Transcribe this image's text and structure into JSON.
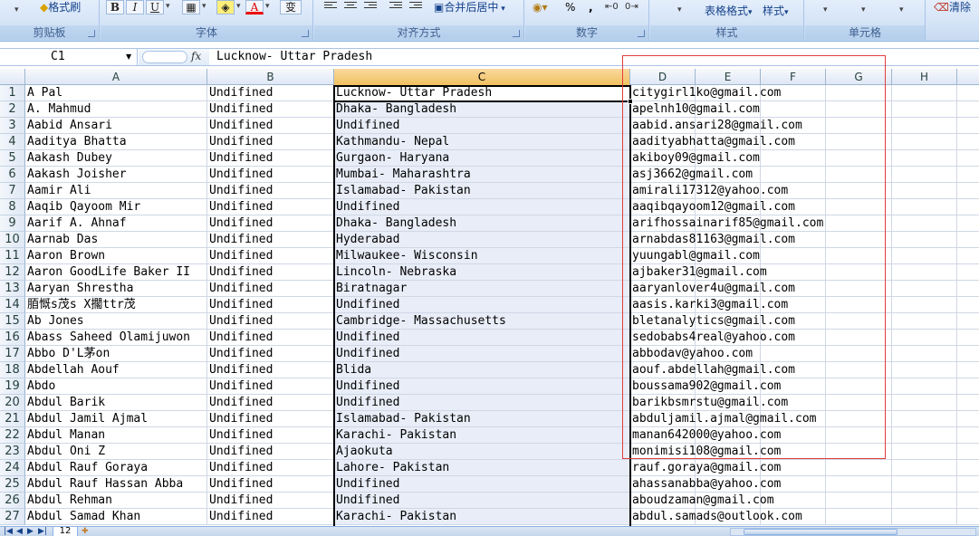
{
  "ribbon": {
    "format_painter_label": "格式刷",
    "clipboard_label": "剪贴板",
    "font_label": "字体",
    "bold_label": "B",
    "italic_label": "I",
    "underline_label": "U",
    "font_color_label": "A",
    "phonetic_label": "变",
    "alignment_label": "对齐方式",
    "merge_center_label": "合并后居中",
    "number_label": "数字",
    "percent_label": "%",
    "comma_label": ",",
    "styles_label": "样式",
    "table_format_label": "表格格式",
    "cell_styles_label": "样式",
    "cells_label": "单元格",
    "clear_label": "清除"
  },
  "formula_bar": {
    "name_box": "C1",
    "fx_label": "fx",
    "content": "Lucknow- Uttar Pradesh"
  },
  "columns": [
    "A",
    "B",
    "C",
    "D",
    "E",
    "F",
    "G",
    "H"
  ],
  "rows": [
    {
      "n": "1",
      "a": "A Pal",
      "b": "Undifined",
      "c": "Lucknow- Uttar Pradesh",
      "d": "citygirl1ko@gmail.com"
    },
    {
      "n": "2",
      "a": "A. Mahmud",
      "b": "Undifined",
      "c": "Dhaka- Bangladesh",
      "d": "apelnh10@gmail.com"
    },
    {
      "n": "3",
      "a": "Aabid Ansari",
      "b": "Undifined",
      "c": "Undifined",
      "d": "aabid.ansari28@gmail.com"
    },
    {
      "n": "4",
      "a": "Aaditya Bhatta",
      "b": "Undifined",
      "c": "Kathmandu- Nepal",
      "d": "aadityabhatta@gmail.com"
    },
    {
      "n": "5",
      "a": "Aakash Dubey",
      "b": "Undifined",
      "c": "Gurgaon- Haryana",
      "d": "akiboy09@gmail.com"
    },
    {
      "n": "6",
      "a": "Aakash Joisher",
      "b": "Undifined",
      "c": "Mumbai- Maharashtra",
      "d": "asj3662@gmail.com"
    },
    {
      "n": "7",
      "a": "Aamir Ali",
      "b": "Undifined",
      "c": "Islamabad- Pakistan",
      "d": "amirali17312@yahoo.com"
    },
    {
      "n": "8",
      "a": "Aaqib Qayoom Mir",
      "b": "Undifined",
      "c": "Undifined",
      "d": "aaqibqayoom12@gmail.com"
    },
    {
      "n": "9",
      "a": "Aarif A. Ahnaf",
      "b": "Undifined",
      "c": "Dhaka- Bangladesh",
      "d": "arifhossainarif85@gmail.com"
    },
    {
      "n": "10",
      "a": "Aarnab Das",
      "b": "Undifined",
      "c": "Hyderabad",
      "d": "arnabdas81163@gmail.com"
    },
    {
      "n": "11",
      "a": "Aaron Brown",
      "b": "Undifined",
      "c": "Milwaukee- Wisconsin",
      "d": "yuungabl@gmail.com"
    },
    {
      "n": "12",
      "a": "Aaron GoodLife Baker II",
      "b": "Undifined",
      "c": "Lincoln- Nebraska",
      "d": "ajbaker31@gmail.com"
    },
    {
      "n": "13",
      "a": "Aaryan Shrestha",
      "b": "Undifined",
      "c": "Biratnagar",
      "d": "aaryanlover4u@gmail.com"
    },
    {
      "n": "14",
      "a": "脜慨s茂s X擱ttr茂",
      "b": "Undifined",
      "c": "Undifined",
      "d": "aasis.karki3@gmail.com"
    },
    {
      "n": "15",
      "a": "Ab Jones",
      "b": "Undifined",
      "c": "Cambridge- Massachusetts",
      "d": "bletanalytics@gmail.com"
    },
    {
      "n": "16",
      "a": "Abass Saheed Olamijuwon",
      "b": "Undifined",
      "c": "Undifined",
      "d": "sedobabs4real@yahoo.com"
    },
    {
      "n": "17",
      "a": "Abbo D'L茅on",
      "b": "Undifined",
      "c": "Undifined",
      "d": "abbodav@yahoo.com"
    },
    {
      "n": "18",
      "a": "Abdellah Aouf",
      "b": "Undifined",
      "c": "Blida",
      "d": "aouf.abdellah@gmail.com"
    },
    {
      "n": "19",
      "a": "Abdo",
      "b": "Undifined",
      "c": "Undifined",
      "d": "boussama902@gmail.com"
    },
    {
      "n": "20",
      "a": "Abdul Barik",
      "b": "Undifined",
      "c": "Undifined",
      "d": "barikbsmrstu@gmail.com"
    },
    {
      "n": "21",
      "a": "Abdul Jamil Ajmal",
      "b": "Undifined",
      "c": "Islamabad- Pakistan",
      "d": "abduljamil.ajmal@gmail.com"
    },
    {
      "n": "22",
      "a": "Abdul Manan",
      "b": "Undifined",
      "c": "Karachi- Pakistan",
      "d": "manan642000@yahoo.com"
    },
    {
      "n": "23",
      "a": "Abdul Oni Z",
      "b": "Undifined",
      "c": "Ajaokuta",
      "d": "monimisi108@gmail.com"
    },
    {
      "n": "24",
      "a": "Abdul Rauf Goraya",
      "b": "Undifined",
      "c": "Lahore- Pakistan",
      "d": "rauf.goraya@gmail.com"
    },
    {
      "n": "25",
      "a": "Abdul Rauf Hassan Abba",
      "b": "Undifined",
      "c": "Undifined",
      "d": "ahassanabba@yahoo.com"
    },
    {
      "n": "26",
      "a": "Abdul Rehman",
      "b": "Undifined",
      "c": "Undifined",
      "d": "aboudzaman@gmail.com"
    },
    {
      "n": "27",
      "a": "Abdul Samad Khan",
      "b": "Undifined",
      "c": "Karachi- Pakistan",
      "d": "abdul.samads@outlook.com"
    }
  ],
  "sheet_tab": {
    "label": "12"
  },
  "colors": {
    "annotation_box": "#e23c3c",
    "selected_header": "#f1c15f",
    "ribbon": "#d5e4f7"
  }
}
